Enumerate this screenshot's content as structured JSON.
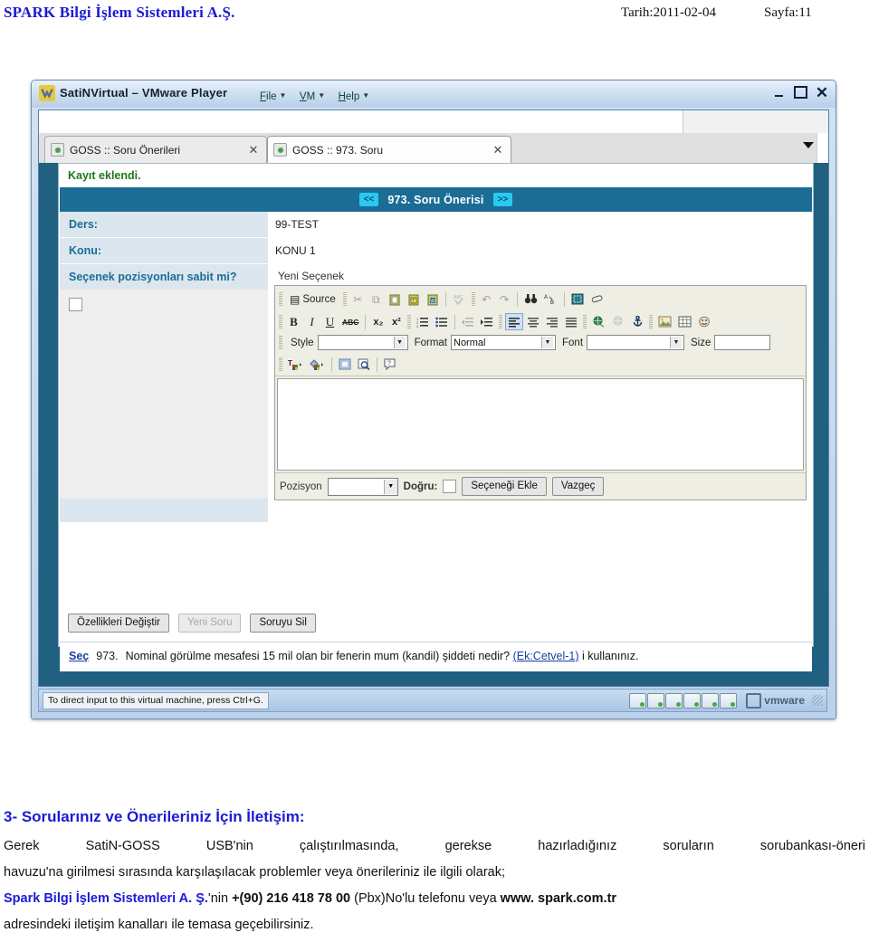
{
  "page_header": {
    "company": "SPARK Bilgi İşlem Sistemleri A.Ş.",
    "date": "Tarih:2011-02-04",
    "page": "Sayfa:11"
  },
  "vmware_window": {
    "title": "SatiNVirtual – VMware Player",
    "menus": [
      "File",
      "VM",
      "Help"
    ],
    "window_buttons": [
      "minimize",
      "maximize",
      "close"
    ],
    "status_tip": "To direct input to this virtual machine, press Ctrl+G.",
    "brand": "vmware"
  },
  "browser": {
    "tabs": [
      {
        "label": "GOSS :: Soru Önerileri",
        "close": "✕",
        "active": false
      },
      {
        "label": "GOSS :: 973. Soru",
        "close": "✕",
        "active": true
      }
    ],
    "tab_list_arrow": "chevron-down"
  },
  "app": {
    "status_message": "Kayıt eklendi.",
    "record_header": {
      "prev": "<<",
      "title": "973. Soru Önerisi",
      "next": ">>"
    },
    "fields": [
      {
        "label": "Ders:",
        "value": "99-TEST"
      },
      {
        "label": "Konu:",
        "value": "KONU 1"
      }
    ],
    "option_fixed": {
      "label": "Seçenek pozisyonları sabit mi?",
      "checked": false
    },
    "editor": {
      "legend": "Yeni Seçenek",
      "toolbar_row1": [
        {
          "name": "source",
          "label": "Source",
          "glyph": "▤"
        },
        {
          "name": "cut",
          "label": "",
          "glyph": "✂"
        },
        {
          "name": "copy",
          "label": "",
          "glyph": "⧉"
        },
        {
          "name": "paste",
          "label": "",
          "glyph": "📋"
        },
        {
          "name": "paste-text",
          "label": "",
          "glyph": "📋"
        },
        {
          "name": "paste-from-word",
          "label": "",
          "glyph": "📋"
        },
        {
          "name": "spell-check",
          "label": "",
          "glyph": "✓"
        },
        {
          "name": "undo",
          "label": "",
          "glyph": "↶"
        },
        {
          "name": "redo",
          "label": "",
          "glyph": "↷"
        },
        {
          "name": "find",
          "label": "",
          "glyph": "🔍"
        },
        {
          "name": "replace",
          "label": "",
          "glyph": "A"
        },
        {
          "name": "select-all",
          "label": "",
          "glyph": "▦"
        },
        {
          "name": "remove-format",
          "label": "",
          "glyph": "⬭"
        }
      ],
      "toolbar_row2": [
        {
          "name": "bold",
          "label": "B",
          "glyph": "B"
        },
        {
          "name": "italic",
          "label": "I",
          "glyph": "I"
        },
        {
          "name": "underline",
          "label": "U",
          "glyph": "U"
        },
        {
          "name": "strike",
          "label": "ABC",
          "glyph": "ABC"
        },
        {
          "name": "subscript",
          "label": "x₂",
          "glyph": "x₂"
        },
        {
          "name": "superscript",
          "label": "x²",
          "glyph": "x²"
        },
        {
          "name": "numbered-list",
          "label": "",
          "glyph": "☰"
        },
        {
          "name": "bulleted-list",
          "label": "",
          "glyph": "☰"
        },
        {
          "name": "outdent",
          "label": "",
          "glyph": "⇤"
        },
        {
          "name": "indent",
          "label": "",
          "glyph": "⇥"
        },
        {
          "name": "align-left",
          "label": "",
          "glyph": "☰",
          "active": true
        },
        {
          "name": "align-center",
          "label": "",
          "glyph": "☰"
        },
        {
          "name": "align-right",
          "label": "",
          "glyph": "☰"
        },
        {
          "name": "justify",
          "label": "",
          "glyph": "☰"
        },
        {
          "name": "link",
          "label": "",
          "glyph": "🌐"
        },
        {
          "name": "unlink",
          "label": "",
          "glyph": "🌐"
        },
        {
          "name": "anchor",
          "label": "",
          "glyph": "⚓"
        },
        {
          "name": "image",
          "label": "",
          "glyph": "🖼"
        },
        {
          "name": "table",
          "label": "",
          "glyph": "▦"
        },
        {
          "name": "smiley",
          "label": "",
          "glyph": "☺"
        }
      ],
      "combos": [
        {
          "name": "style",
          "label": "Style",
          "value": ""
        },
        {
          "name": "format",
          "label": "Format",
          "value": "Normal"
        },
        {
          "name": "font",
          "label": "Font",
          "value": ""
        },
        {
          "name": "size",
          "label": "Size",
          "value": ""
        }
      ],
      "toolbar_row4": [
        {
          "name": "text-color",
          "glyph": "T"
        },
        {
          "name": "background-color",
          "glyph": "▧"
        },
        {
          "name": "show-blocks",
          "glyph": "▣"
        },
        {
          "name": "preview",
          "glyph": "🔎"
        },
        {
          "name": "about",
          "glyph": "?"
        }
      ],
      "content": "",
      "footer": {
        "position_label": "Pozisyon",
        "position_value": "",
        "correct_label": "Doğru:",
        "correct_checked": false,
        "add_button": "Seçeneği Ekle",
        "cancel_button": "Vazgeç"
      }
    },
    "actions": [
      {
        "label": "Özellikleri Değiştir",
        "disabled": false
      },
      {
        "label": "Yeni Soru",
        "disabled": true
      },
      {
        "label": "Soruyu Sil",
        "disabled": false
      }
    ],
    "question_row": {
      "select_link": "Seç",
      "number": "973.",
      "text_before": "Nominal görülme mesafesi 15 mil olan bir fenerin mum (kandil) şiddeti nedir? ",
      "link": "(Ek:Cetvel-1)",
      "text_after": " i kullanınız."
    }
  },
  "article": {
    "heading": "3- Sorularınız ve Önerileriniz İçin İletişim:",
    "paragraph1": "Gerek SatiN-GOSS USB'nin çalıştırılmasında, gerekse hazırladığınız soruların sorubankası-öneri",
    "paragraph1b": "havuzu'na girilmesi sırasında karşılaşılacak problemler veya önerileriniz ile ilgili olarak;",
    "company": "Spark Bilgi İşlem Sistemleri A. Ş.",
    "company_suffix": "'nin ",
    "phone": "+(90) 216 418 78 00",
    "phone_suffix": " (Pbx)No'lu telefonu veya ",
    "website": "www. spark.com.tr",
    "paragraph3": "adresindeki iletişim kanalları ile temasa geçebilirsiniz."
  },
  "colors": {
    "brand_blue": "#1b1bd4",
    "app_header_blue": "#1b6d96",
    "label_bg": "#dbe6ee",
    "nav_cyan": "#29c8f0",
    "success_green": "#1b7a1b",
    "vm_desktop": "#206080"
  }
}
